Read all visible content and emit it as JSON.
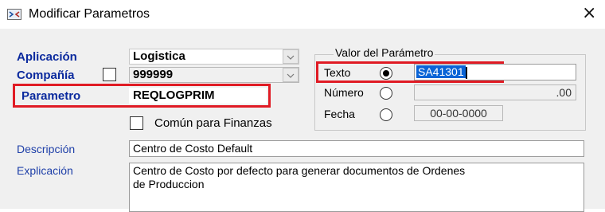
{
  "window": {
    "title": "Modificar Parametros",
    "close_glyph": "×"
  },
  "form": {
    "aplicacion": {
      "label": "Aplicación",
      "value": "Logistica"
    },
    "compania": {
      "label": "Compañía",
      "value": "999999"
    },
    "parametro": {
      "label": "Parametro",
      "value": "REQLOGPRIM"
    },
    "comun_finanzas": {
      "label": "Común para Finanzas",
      "checked": false
    },
    "descripcion": {
      "label": "Descripción",
      "value": "Centro de Costo Default"
    },
    "explicacion": {
      "label": "Explicación",
      "line1": "Centro de Costo por defecto para generar documentos de Ordenes",
      "line2": "de Produccion"
    }
  },
  "valor": {
    "title": "Valor del Parámetro",
    "texto": {
      "label": "Texto",
      "value": "SA41301",
      "selected": true
    },
    "numero": {
      "label": "Número",
      "value": ".00",
      "selected": false
    },
    "fecha": {
      "label": "Fecha",
      "value": "00-00-0000",
      "selected": false
    }
  },
  "colors": {
    "highlight": "#e01b24",
    "label_blue": "#0b2a9e",
    "selection": "#0a64d6"
  },
  "icons": {
    "app": "window-app-icon",
    "close": "close-icon",
    "dropdown": "chevron-down-icon"
  }
}
